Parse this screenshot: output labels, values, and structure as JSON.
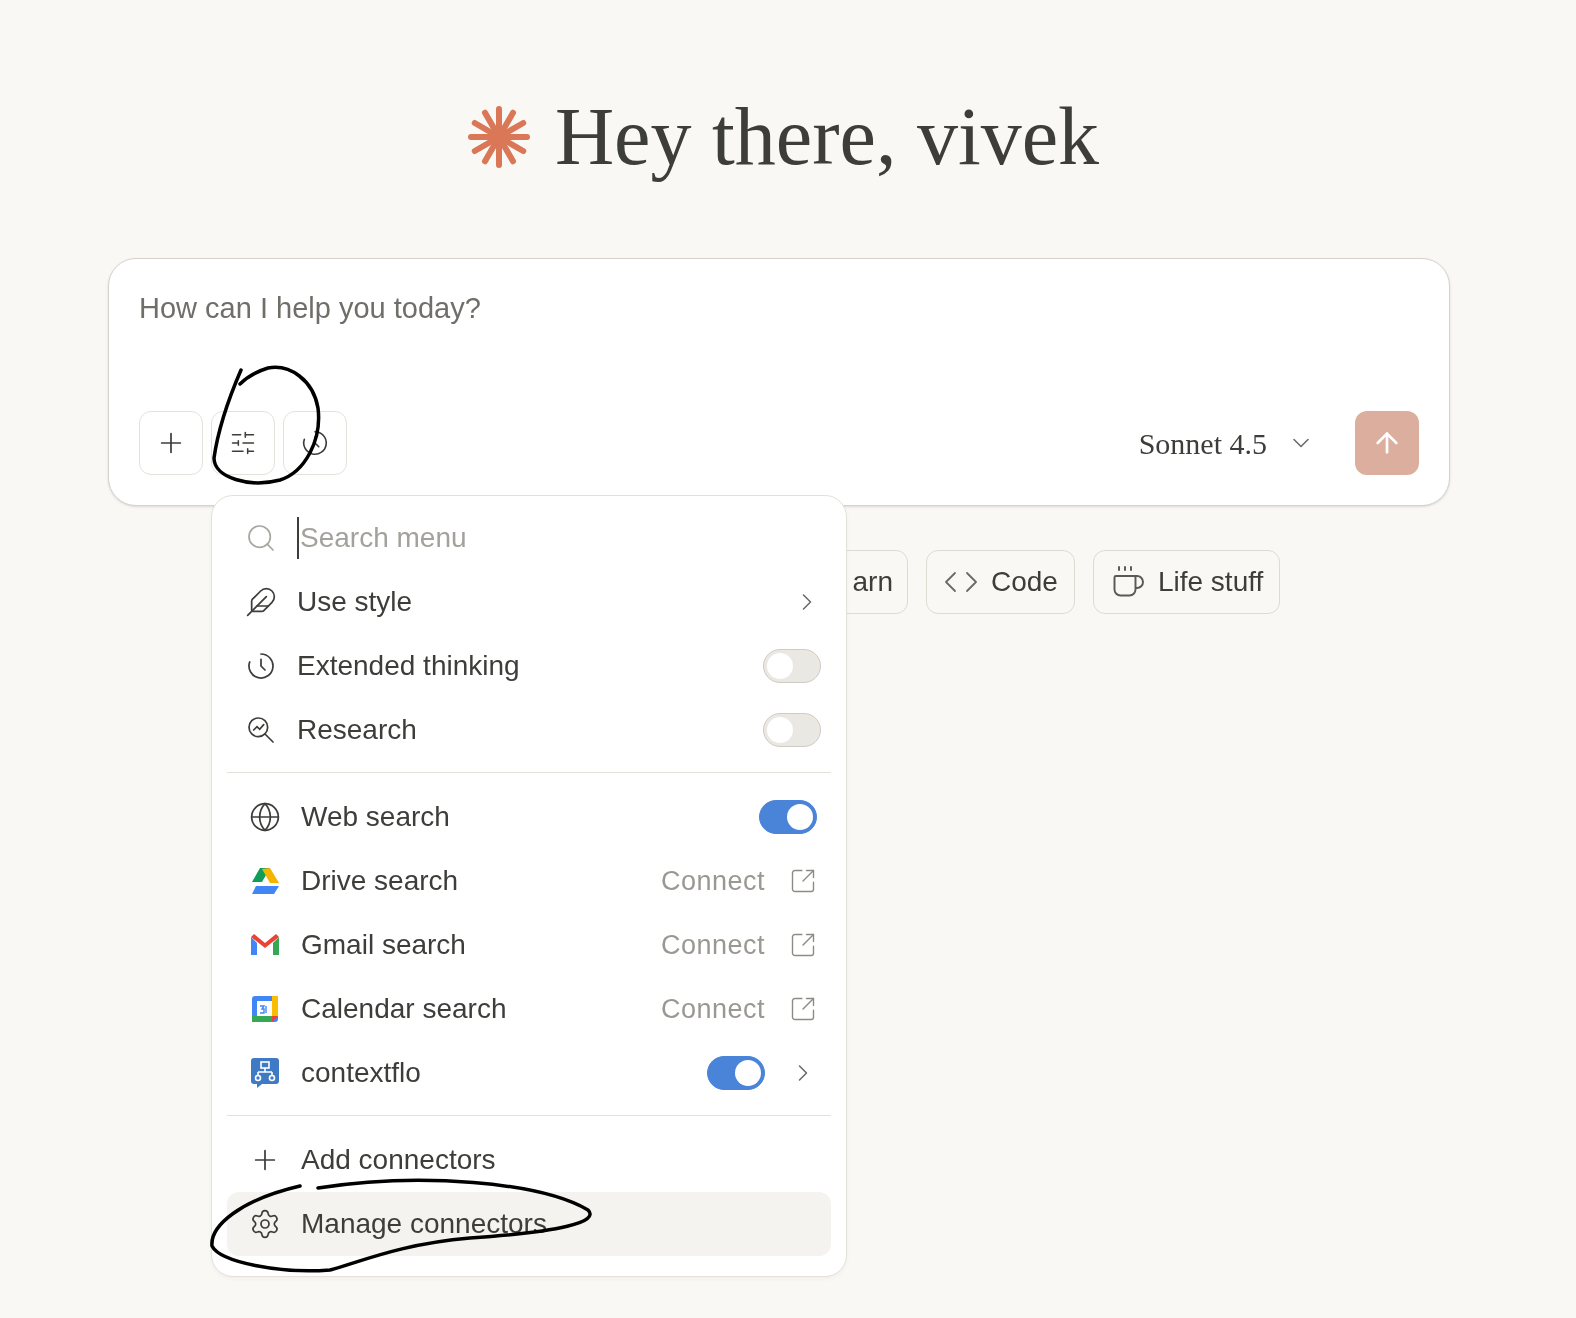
{
  "greeting": {
    "text": "Hey there, vivek"
  },
  "composer": {
    "placeholder": "How can I help you today?",
    "model": "Sonnet 4.5"
  },
  "chips": [
    {
      "label": "arn"
    },
    {
      "label": "Code"
    },
    {
      "label": "Life stuff"
    }
  ],
  "menu": {
    "search_placeholder": "Search menu",
    "sections": [
      [
        {
          "kind": "submenu",
          "label": "Use style",
          "highlighted": false
        },
        {
          "kind": "toggle",
          "label": "Extended thinking",
          "on": false,
          "highlighted": false
        },
        {
          "kind": "toggle",
          "label": "Research",
          "on": false,
          "highlighted": false
        }
      ],
      [
        {
          "kind": "toggle",
          "label": "Web search",
          "on": true,
          "highlighted": false
        },
        {
          "kind": "connect",
          "label": "Drive search",
          "action": "Connect",
          "highlighted": false
        },
        {
          "kind": "connect",
          "label": "Gmail search",
          "action": "Connect",
          "highlighted": false
        },
        {
          "kind": "connect",
          "label": "Calendar search",
          "action": "Connect",
          "highlighted": false
        },
        {
          "kind": "toggle_submenu",
          "label": "contextflo",
          "on": true,
          "highlighted": false
        }
      ],
      [
        {
          "kind": "action",
          "label": "Add connectors",
          "highlighted": false
        },
        {
          "kind": "action",
          "label": "Manage connectors",
          "highlighted": true
        }
      ]
    ]
  }
}
